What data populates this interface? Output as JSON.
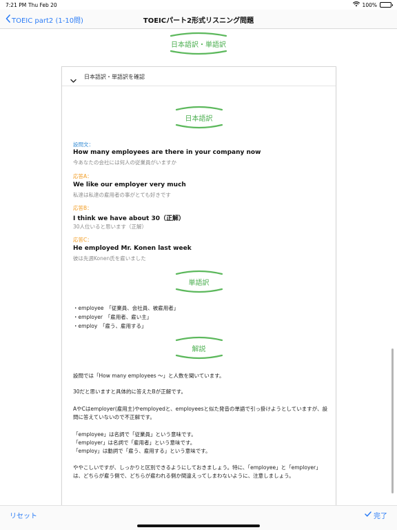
{
  "status": {
    "time": "7:21 PM",
    "date": "Thu Feb 20",
    "battery": "100%"
  },
  "nav": {
    "back_label": "TOEIC part2 (1-10問)",
    "title": "TOEICパート2形式リスニング問題"
  },
  "top_heading": "日本語訳・単語訳",
  "card": {
    "header": "日本語訳・単語訳を確認",
    "translation_heading": "日本語訳",
    "question_label": "設問文：",
    "question_en": "How many employees are there in your company now",
    "question_ja": "今あなたの会社には何人の従業員がいますか",
    "a_label": "応答A：",
    "a_en": "We like our employer very much",
    "a_ja": "私達は私達の雇用者の事がとても好きです",
    "b_label": "応答B：",
    "b_en": "I think we have about 30（正解）",
    "b_ja": "30人位いると思います（正解）",
    "c_label": "応答C：",
    "c_en": "He employed Mr. Konen last week",
    "c_ja": "彼は先週Konen氏を雇いました",
    "vocab_heading": "単語訳",
    "vocab": [
      "・employee　「従業員、会社員、被雇用者」",
      "・employer　「雇用者、雇い主」",
      "・employ　「雇う、雇用する」"
    ],
    "explanation_heading": "解説",
    "explanation": [
      "設問では「How many employees 〜」と人数を聞いています。",
      "30だと思いますと具体的に答えたBが正解です。",
      "AやCはemployer(雇用主)やemployedと、employeesと似た発音の単語で引っ掛けようとしていますが、設問に答えていないので不正解です。",
      "「employee」は名詞で「従業員」という意味です。",
      "「employer」は名詞で「雇用者」という意味です。",
      "「employ」は動詞で「雇う、雇用する」という意味です。",
      "ややこしいですが、しっかりと区別できるようにしておきましょう。特に、「employee」と「employer」は、どちらが雇う側で、どちらが雇われる側か間違えってしまわないように、注意しましょう。"
    ]
  },
  "toolbar": {
    "reset_label": "リセット",
    "done_label": "完了"
  },
  "colors": {
    "accent": "#2b7cf6",
    "green": "#4caf50",
    "blue_label": "#3a8fd6",
    "orange_label": "#f29a1d"
  }
}
